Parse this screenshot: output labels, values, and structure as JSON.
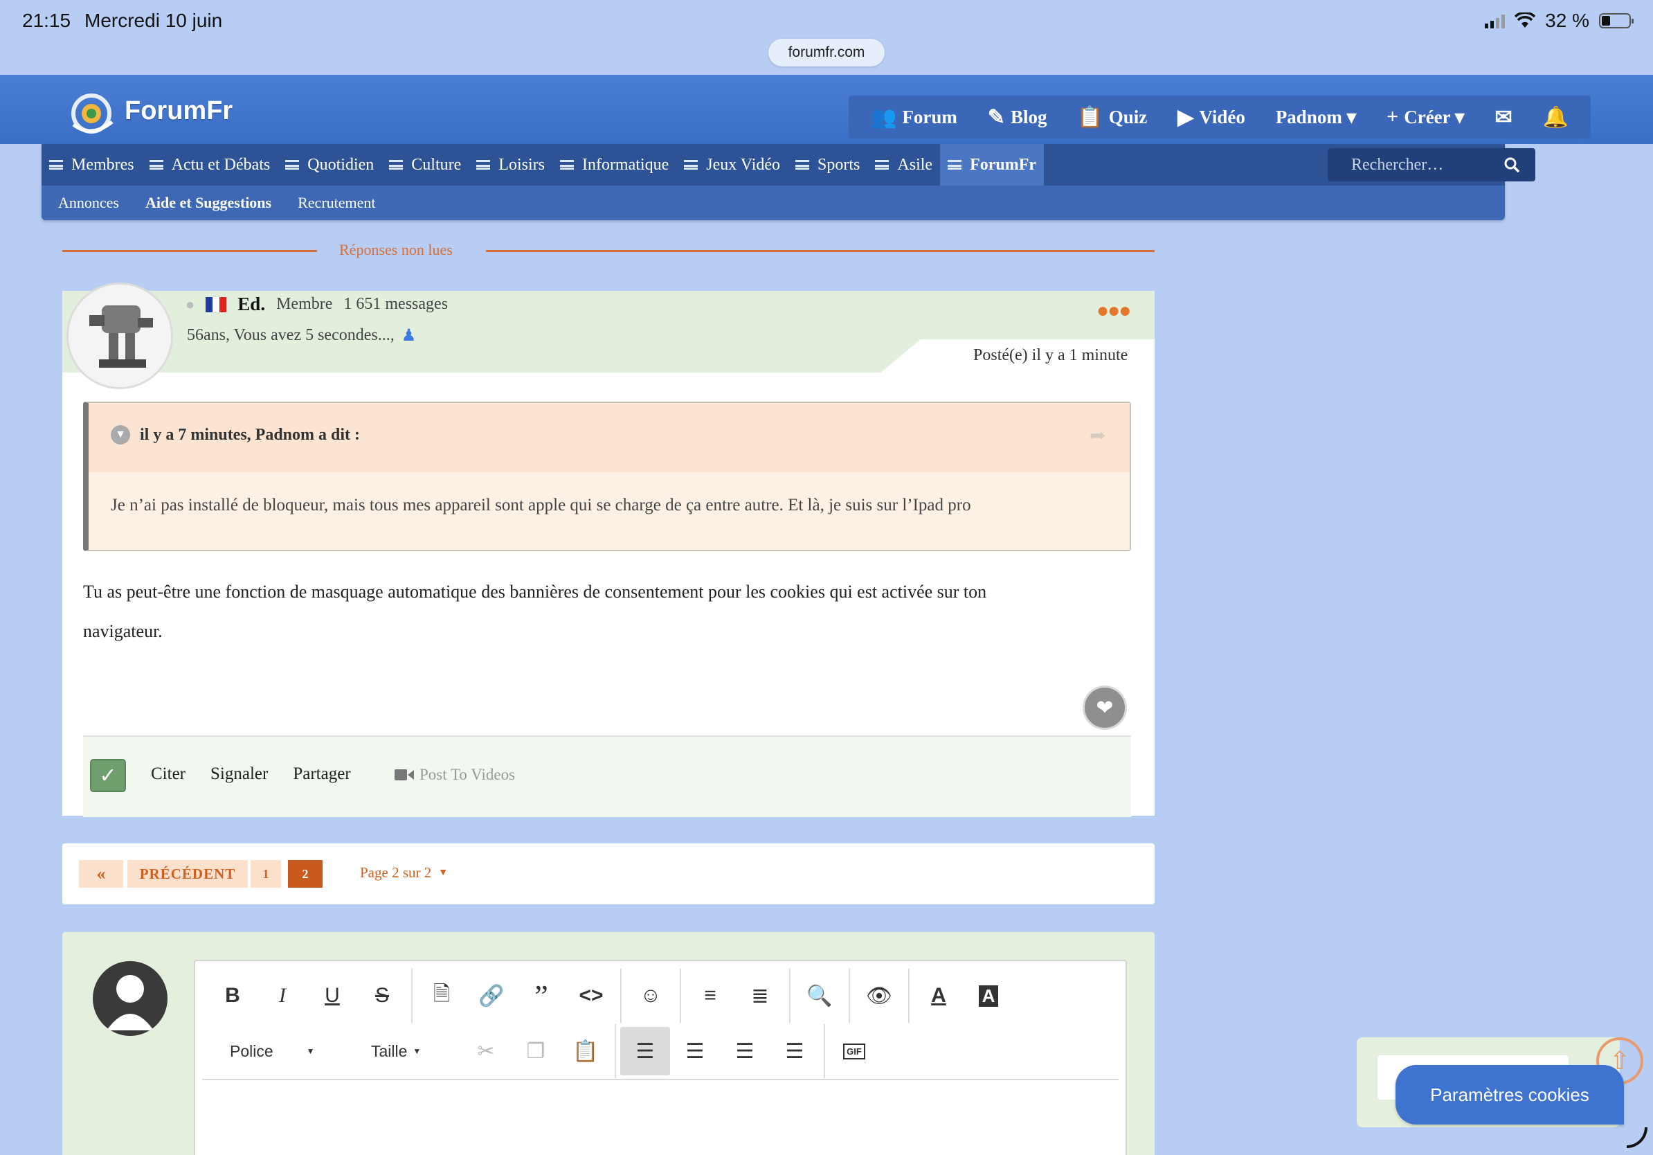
{
  "status_bar": {
    "time": "21:15",
    "date": "Mercredi 10 juin",
    "battery": "32 %"
  },
  "browser": {
    "url": "forumfr.com"
  },
  "site": {
    "logo_text": "ForumFr",
    "top_nav": [
      {
        "label": "Forum",
        "icon": "users-icon"
      },
      {
        "label": "Blog",
        "icon": "pen-icon"
      },
      {
        "label": "Quiz",
        "icon": "clipboard-icon"
      },
      {
        "label": "Vidéo",
        "icon": "play-icon"
      },
      {
        "label": "Padnom ▾",
        "icon": ""
      },
      {
        "label": "Créer ▾",
        "icon": "plus-icon"
      }
    ],
    "menu": [
      "Membres",
      "Actu et Débats",
      "Quotidien",
      "Culture",
      "Loisirs",
      "Informatique",
      "Jeux Vidéo",
      "Sports",
      "Asile",
      "ForumFr"
    ],
    "menu_active_index": 9,
    "submenu": [
      "Annonces",
      "Aide et Suggestions",
      "Recrutement"
    ],
    "search_placeholder": "Rechercher…"
  },
  "separator": "Réponses non lues",
  "post": {
    "author": "Ed.",
    "role": "Membre",
    "messages": "1 651 messages",
    "info": "56ans, Vous avez 5 secondes...,",
    "posted": "Posté(e) il y a 1 minute",
    "quote": {
      "header": "il y a 7 minutes, Padnom a dit :",
      "text": "Je n’ai pas installé de bloqueur, mais tous mes appareil sont apple qui se charge de ça entre autre. Et là, je suis sur l’Ipad pro"
    },
    "body_line1": "Tu as peut-être une fonction de masquage automatique des bannières de consentement pour les cookies qui est activée sur ton",
    "body_line2": "navigateur.",
    "actions": [
      "Citer",
      "Signaler",
      "Partager"
    ],
    "post_to_videos": "Post To Videos"
  },
  "pagination": {
    "prev": "PRÉCÉDENT",
    "pages": [
      "1",
      "2"
    ],
    "current": "2",
    "page_of": "Page 2 sur 2"
  },
  "editor": {
    "font_label": "Police",
    "size_label": "Taille",
    "gif_label": "GIF"
  },
  "cookies_button": "Paramètres cookies",
  "colors": {
    "header_blue": "#3b6fc6",
    "menu_blue": "#2d5296",
    "accent_orange": "#d96e36",
    "post_header_green": "#e1efdc",
    "cookie_blue": "#3e74cf"
  }
}
